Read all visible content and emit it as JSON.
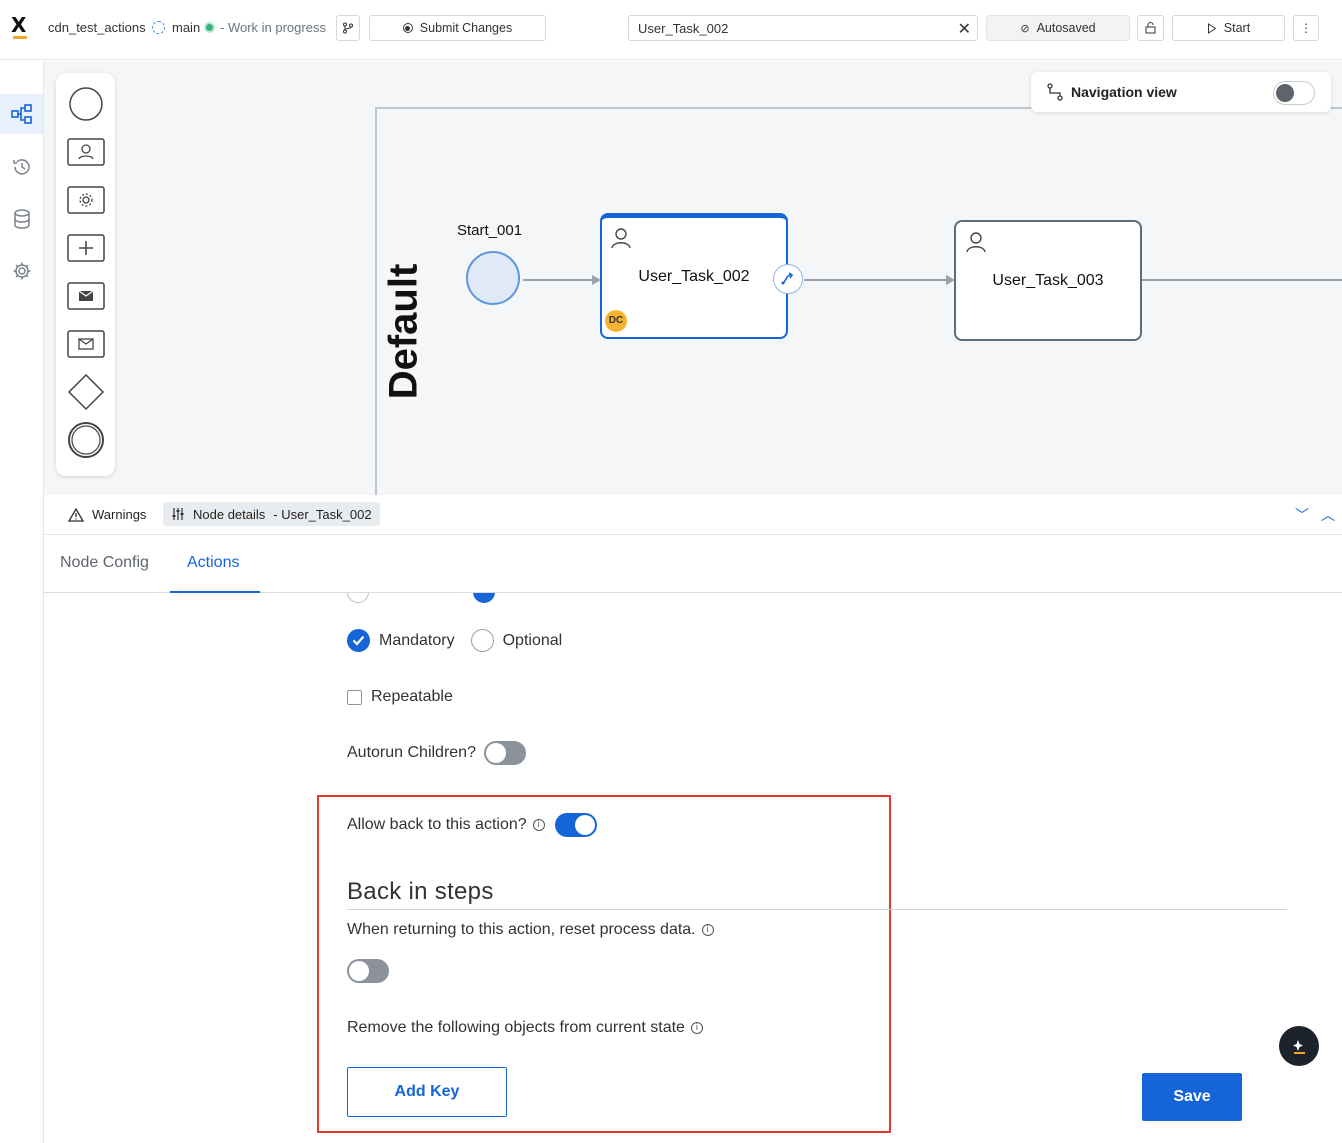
{
  "header": {
    "project_name": "cdn_test_actions",
    "branch": "main",
    "status": "- Work in progress",
    "submit_label": "Submit Changes",
    "search_value": "User_Task_002",
    "autosaved_label": "Autosaved",
    "start_label": "Start"
  },
  "canvas": {
    "nav_view_label": "Navigation view",
    "nav_view_enabled": false,
    "pool_label": "Default",
    "start_event_label": "Start_001",
    "tasks": [
      {
        "name": "User_Task_002",
        "badge": "DC",
        "selected": true
      },
      {
        "name": "User_Task_003",
        "selected": false
      }
    ]
  },
  "panel": {
    "warnings_label": "Warnings",
    "node_details_label": "Node details",
    "node_details_name": "- User_Task_002",
    "tabs": [
      {
        "label": "Node Config",
        "active": false
      },
      {
        "label": "Actions",
        "active": true
      }
    ]
  },
  "form": {
    "mandatory_label": "Mandatory",
    "optional_label": "Optional",
    "mandatory_selected": true,
    "repeatable_label": "Repeatable",
    "repeatable_checked": false,
    "autorun_label": "Autorun Children?",
    "autorun_enabled": false,
    "allow_back_label": "Allow back to this action?",
    "allow_back_enabled": true,
    "back_section_title": "Back in steps",
    "reset_label": "When returning to this action, reset process data.",
    "reset_enabled": false,
    "remove_label": "Remove the following objects from current state",
    "add_key_label": "Add Key",
    "save_label": "Save"
  },
  "colors": {
    "accent": "#1565d8",
    "highlight": "#e03a2a",
    "badge": "#f5b333"
  }
}
